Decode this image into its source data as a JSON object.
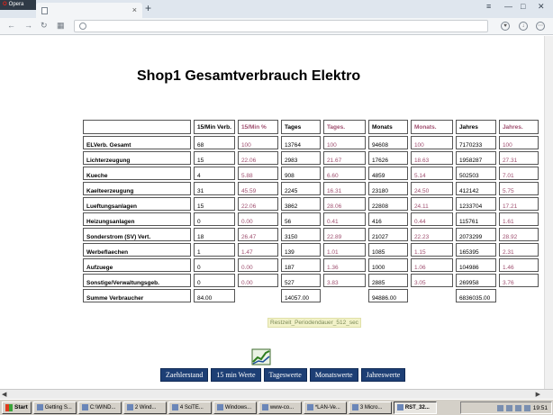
{
  "browser": {
    "menu_label": "Opera",
    "new_tab_symbol": "+",
    "tab_close": "×"
  },
  "page": {
    "title": "Shop1 Gesamtverbrauch Elektro",
    "restzeit": "Restzeit_Periodendauer_512_sec"
  },
  "table": {
    "headers": [
      "",
      "15/Min Verb.",
      "15/Min %",
      "Tages",
      "Tages.",
      "Monats",
      "Monats.",
      "Jahres",
      "Jahres."
    ],
    "rows": [
      {
        "label": "ELVerb. Gesamt",
        "v": [
          "68",
          "100",
          "13764",
          "100",
          "94608",
          "100",
          "7170233",
          "100"
        ]
      },
      {
        "label": "Lichterzeugung",
        "v": [
          "15",
          "22.06",
          "2983",
          "21.67",
          "17626",
          "18.63",
          "1958287",
          "27.31"
        ]
      },
      {
        "label": "Kueche",
        "v": [
          "4",
          "5.88",
          "908",
          "6.60",
          "4859",
          "5.14",
          "502503",
          "7.01"
        ]
      },
      {
        "label": "Kaelteerzeugung",
        "v": [
          "31",
          "45.59",
          "2245",
          "16.31",
          "23180",
          "24.50",
          "412142",
          "5.75"
        ]
      },
      {
        "label": "Lueftungsanlagen",
        "v": [
          "15",
          "22.06",
          "3862",
          "28.06",
          "22808",
          "24.11",
          "1233704",
          "17.21"
        ]
      },
      {
        "label": "Heizungsanlagen",
        "v": [
          "0",
          "0.00",
          "56",
          "0.41",
          "416",
          "0.44",
          "115761",
          "1.61"
        ]
      },
      {
        "label": "Sonderstrom (SV) Vert.",
        "v": [
          "18",
          "26.47",
          "3150",
          "22.89",
          "21027",
          "22.23",
          "2073299",
          "28.92"
        ]
      },
      {
        "label": "Werbeflaechen",
        "v": [
          "1",
          "1.47",
          "139",
          "1.01",
          "1085",
          "1.15",
          "165395",
          "2.31"
        ]
      },
      {
        "label": "Aufzuege",
        "v": [
          "0",
          "0.00",
          "187",
          "1.36",
          "1000",
          "1.06",
          "104986",
          "1.46"
        ]
      },
      {
        "label": "Sonstige/Verwaltungsgeb.",
        "v": [
          "0",
          "0.00",
          "527",
          "3.83",
          "2885",
          "3.05",
          "269958",
          "3.76"
        ]
      }
    ],
    "sum": {
      "label": "Summe Verbraucher",
      "min": "84.00",
      "tages": "14057.00",
      "monats": "94886.00",
      "jahres": "6836035.00"
    }
  },
  "nav": [
    "Zaehlerstand",
    "15 min Werte",
    "Tageswerte",
    "Monatswerte",
    "Jahreswerte"
  ],
  "taskbar": {
    "start": "Start",
    "items": [
      "Getting S...",
      "C:\\WIND...",
      "2 Wind...",
      "4 SciTE...",
      "Windows...",
      "www-co...",
      "*LAN-Ve...",
      "3 Micro...",
      "RST_32..."
    ],
    "active_index": 8,
    "clock": "19:51"
  },
  "colors": {
    "nav_button": "#1d3f75",
    "percent_text": "#a05070",
    "restzeit_bg": "#f2f2c9"
  }
}
